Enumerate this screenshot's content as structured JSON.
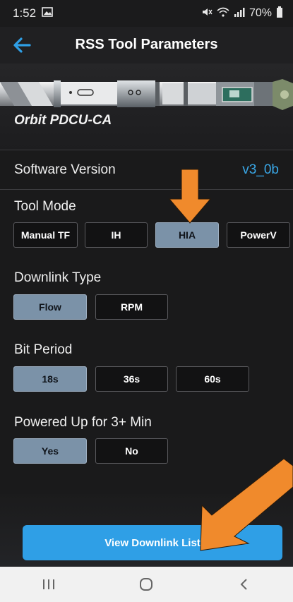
{
  "status": {
    "time": "1:52",
    "battery": "70%"
  },
  "appbar": {
    "title": "RSS Tool Parameters"
  },
  "tool": {
    "name": "Orbit PDCU-CA"
  },
  "software": {
    "label": "Software Version",
    "value": "v3_0b"
  },
  "tool_mode": {
    "label": "Tool Mode",
    "options": [
      "Manual TF",
      "IH",
      "HIA",
      "PowerV"
    ],
    "selected": "HIA"
  },
  "downlink_type": {
    "label": "Downlink Type",
    "options": [
      "Flow",
      "RPM"
    ],
    "selected": "Flow"
  },
  "bit_period": {
    "label": "Bit Period",
    "options": [
      "18s",
      "36s",
      "60s"
    ],
    "selected": "18s"
  },
  "powered_up": {
    "label": "Powered Up for 3+ Min",
    "options": [
      "Yes",
      "No"
    ],
    "selected": "Yes"
  },
  "cta": {
    "label": "View Downlink List"
  },
  "colors": {
    "accent": "#2f9fe6",
    "selected": "#7b92a8",
    "annotation": "#f08a2c"
  }
}
